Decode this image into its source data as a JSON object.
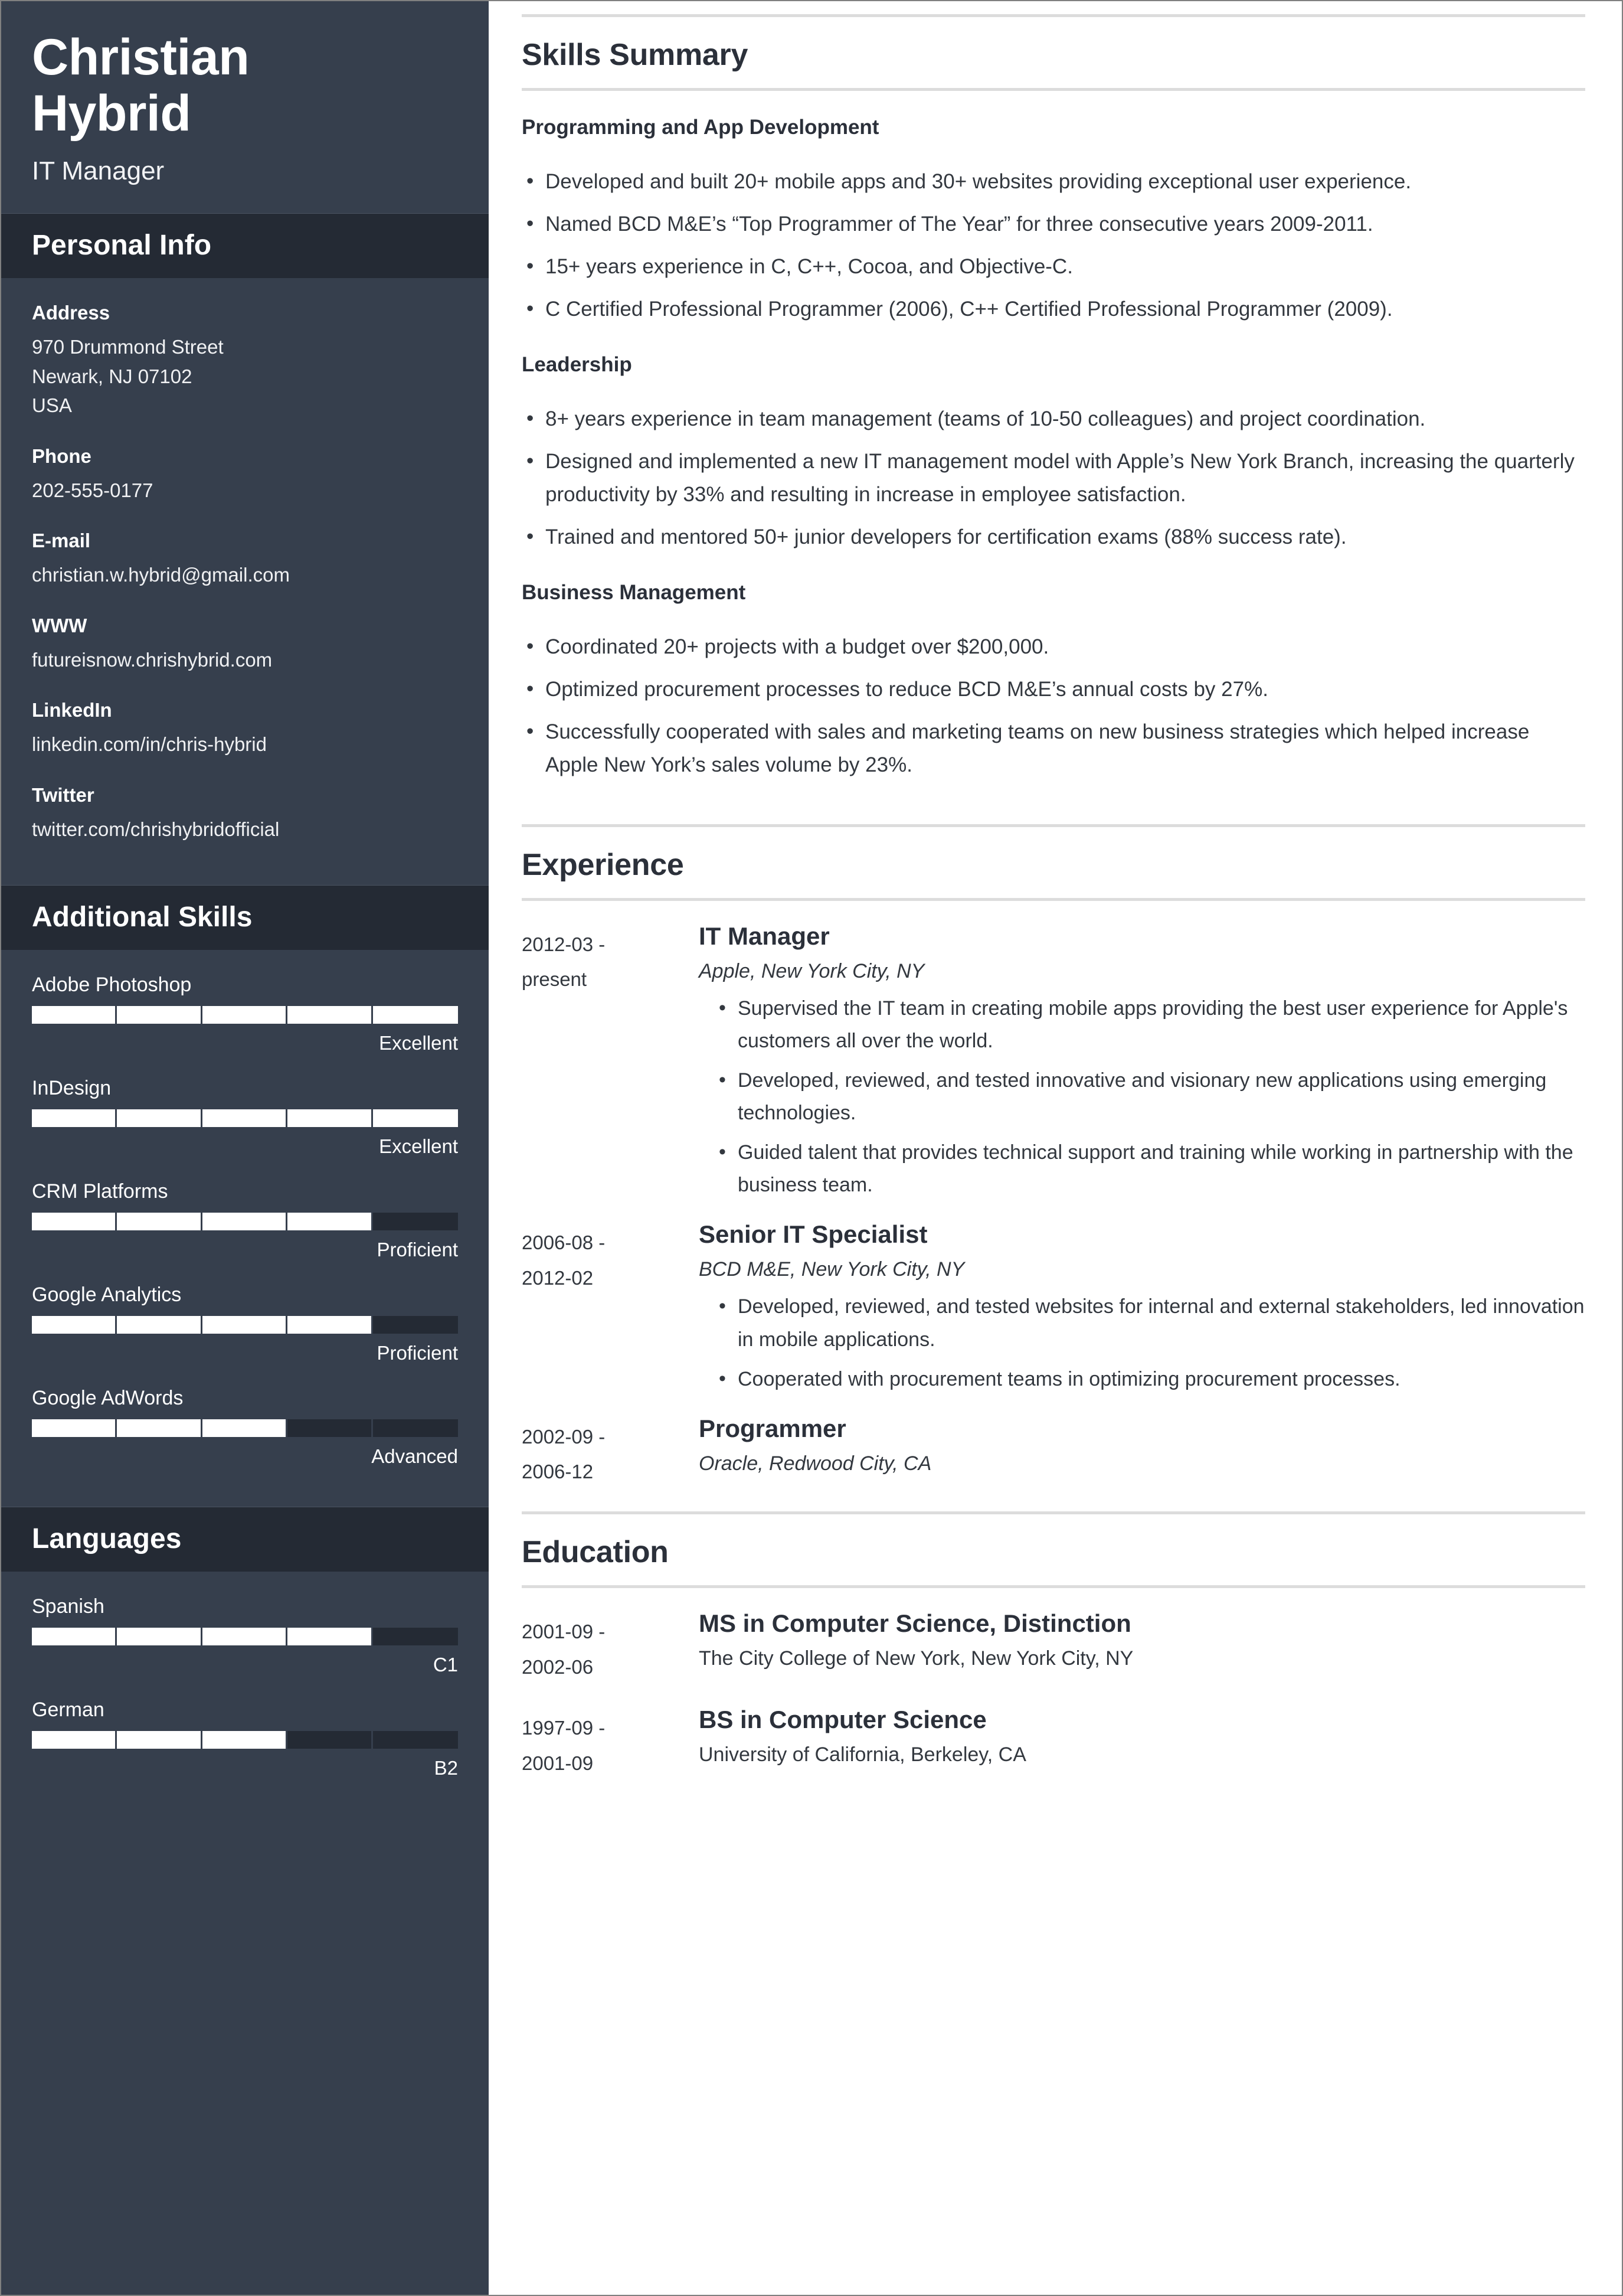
{
  "resume": {
    "header": {
      "first_name": "Christian",
      "last_name": "Hybrid",
      "job_title": "IT Manager"
    },
    "sidebar": {
      "personal_info": {
        "heading": "Personal Info",
        "fields": [
          {
            "label": "Address",
            "value": "970 Drummond Street\nNewark, NJ 07102\nUSA"
          },
          {
            "label": "Phone",
            "value": "202-555-0177"
          },
          {
            "label": "E-mail",
            "value": "christian.w.hybrid@gmail.com"
          },
          {
            "label": "WWW",
            "value": "futureisnow.chrishybrid.com"
          },
          {
            "label": "LinkedIn",
            "value": "linkedin.com/in/chris-hybrid"
          },
          {
            "label": "Twitter",
            "value": "twitter.com/chrishybridofficial"
          }
        ]
      },
      "additional_skills": {
        "heading": "Additional Skills",
        "items": [
          {
            "name": "Adobe Photoshop",
            "level": "Excellent",
            "filled": 5,
            "total": 5
          },
          {
            "name": "InDesign",
            "level": "Excellent",
            "filled": 5,
            "total": 5
          },
          {
            "name": "CRM Platforms",
            "level": "Proficient",
            "filled": 4,
            "total": 5
          },
          {
            "name": "Google Analytics",
            "level": "Proficient",
            "filled": 4,
            "total": 5
          },
          {
            "name": "Google AdWords",
            "level": "Advanced",
            "filled": 3,
            "total": 5
          }
        ]
      },
      "languages": {
        "heading": "Languages",
        "items": [
          {
            "name": "Spanish",
            "level": "C1",
            "filled": 4,
            "total": 5
          },
          {
            "name": "German",
            "level": "B2",
            "filled": 3,
            "total": 5
          }
        ]
      }
    },
    "main": {
      "skills_summary": {
        "heading": "Skills Summary",
        "groups": [
          {
            "subheading": "Programming and App Development",
            "bullets": [
              "Developed and built 20+ mobile apps and 30+ websites providing exceptional user experience.",
              "Named BCD M&E’s “Top Programmer of The Year” for three consecutive years 2009-2011.",
              "15+ years experience in C, C++, Cocoa, and Objective-C.",
              "C Certified Professional Programmer (2006), C++ Certified Professional Programmer (2009)."
            ]
          },
          {
            "subheading": "Leadership",
            "bullets": [
              "8+ years experience in team management (teams of 10-50 colleagues) and project coordination.",
              "Designed and implemented a new IT management model with Apple’s New York Branch, increasing the quarterly productivity by 33% and resulting in increase in employee satisfaction.",
              "Trained and mentored 50+ junior developers for certification exams (88% success rate)."
            ]
          },
          {
            "subheading": "Business Management",
            "bullets": [
              "Coordinated 20+ projects with a budget over $200,000.",
              "Optimized procurement processes to reduce BCD M&E’s annual costs by 27%.",
              "Successfully cooperated with sales and marketing teams on new business strategies which helped increase Apple New York’s sales volume by 23%."
            ]
          }
        ]
      },
      "experience": {
        "heading": "Experience",
        "entries": [
          {
            "date_start": "2012-03 -",
            "date_end": "present",
            "title": "IT Manager",
            "organization": "Apple, New York City, NY",
            "bullets": [
              "Supervised the IT team in creating mobile apps providing the best user experience for Apple's customers all over the world.",
              "Developed, reviewed, and tested innovative and visionary new applications using emerging technologies.",
              "Guided talent that provides technical support and training while working in partnership with the business team."
            ]
          },
          {
            "date_start": "2006-08 -",
            "date_end": "2012-02",
            "title": "Senior IT Specialist",
            "organization": "BCD M&E, New York City, NY",
            "bullets": [
              "Developed, reviewed, and tested websites for internal and external stakeholders, led innovation in mobile applications.",
              "Cooperated with procurement teams in optimizing procurement processes."
            ]
          },
          {
            "date_start": "2002-09 -",
            "date_end": "2006-12",
            "title": "Programmer",
            "organization": "Oracle, Redwood City, CA",
            "bullets": []
          }
        ]
      },
      "education": {
        "heading": "Education",
        "entries": [
          {
            "date_start": "2001-09 -",
            "date_end": "2002-06",
            "title": "MS in Computer Science, Distinction",
            "organization": "The City College of New York, New York City, NY"
          },
          {
            "date_start": "1997-09 -",
            "date_end": "2001-09",
            "title": "BS in Computer Science",
            "organization": "University of California, Berkeley, CA"
          }
        ]
      }
    },
    "colors": {
      "sidebar_bg": "#363f4d",
      "sidebar_header_bg": "#242a34",
      "text_dark": "#2b303a",
      "rule": "#dcdcdc",
      "bar_fill": "#ffffff",
      "bar_track": "#242a34"
    }
  }
}
